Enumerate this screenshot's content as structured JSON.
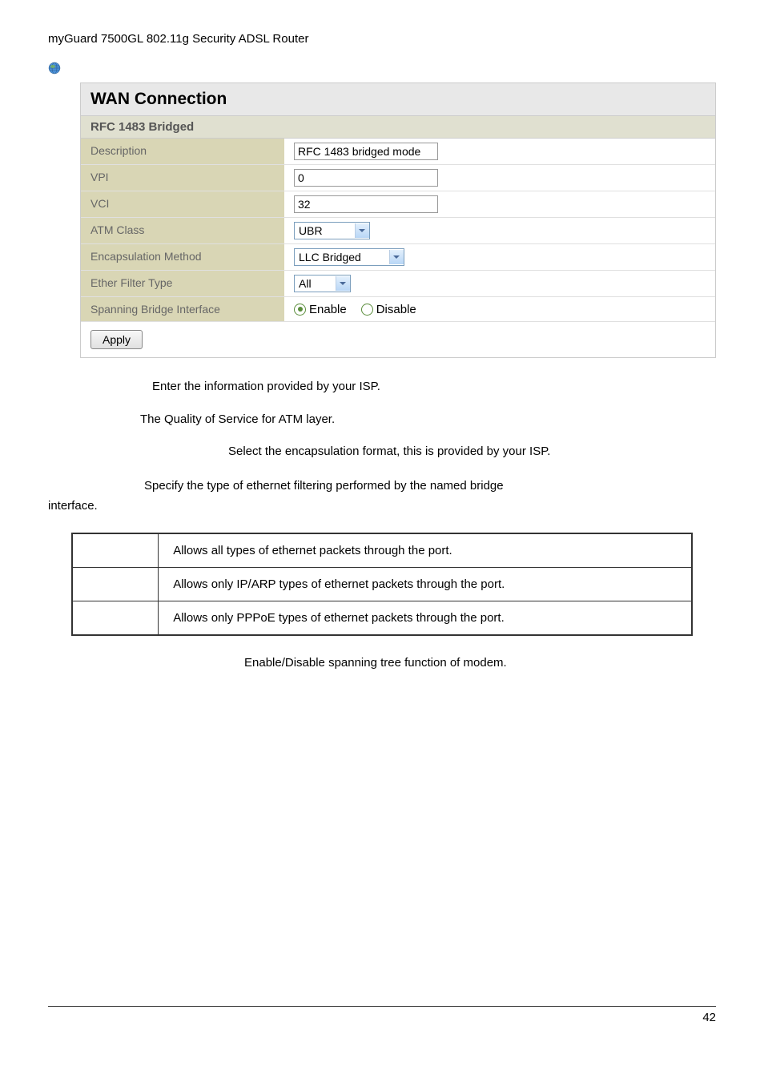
{
  "header": "myGuard 7500GL 802.11g Security ADSL Router",
  "panel": {
    "title": "WAN Connection",
    "subtitle": "RFC 1483 Bridged",
    "rows": {
      "description": {
        "label": "Description",
        "value": "RFC 1483 bridged mode"
      },
      "vpi": {
        "label": "VPI",
        "value": "0"
      },
      "vci": {
        "label": "VCI",
        "value": "32"
      },
      "atm": {
        "label": "ATM Class",
        "value": "UBR"
      },
      "encap": {
        "label": "Encapsulation Method",
        "value": "LLC Bridged"
      },
      "ether": {
        "label": "Ether Filter Type",
        "value": "All"
      },
      "spanning": {
        "label": "Spanning Bridge Interface",
        "enable": "Enable",
        "disable": "Disable"
      }
    },
    "apply": "Apply"
  },
  "body": {
    "d1": "Enter the information provided by your ISP.",
    "d2": "The Quality of Service for ATM layer.",
    "d3": "Select the encapsulation format, this is provided by your ISP.",
    "d4a": "Specify the type of ethernet filtering performed by the named bridge",
    "d4b": "interface.",
    "t1": "Allows all types of ethernet packets through the port.",
    "t2": "Allows only IP/ARP types of ethernet packets through the port.",
    "t3": "Allows only PPPoE types of ethernet packets through the port.",
    "d5": "Enable/Disable spanning tree function of modem."
  },
  "pageNumber": "42"
}
